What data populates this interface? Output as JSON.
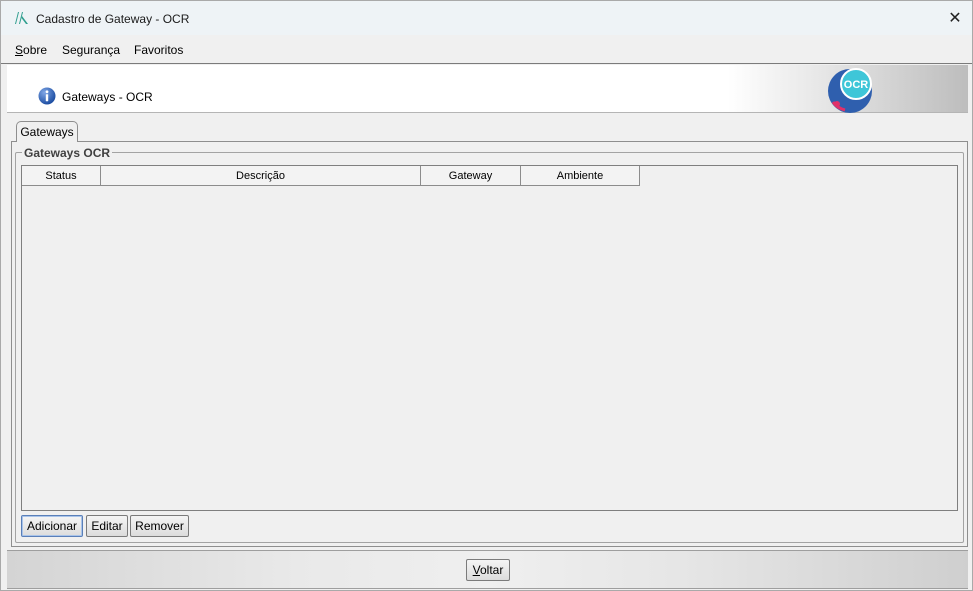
{
  "window": {
    "title": "Cadastro de Gateway - OCR",
    "close_label": "✕"
  },
  "menu": {
    "items": [
      {
        "label_first": "S",
        "label_rest": "obre",
        "full": "Sobre"
      },
      {
        "label": "Segurança"
      },
      {
        "label": "Favoritos"
      }
    ]
  },
  "banner": {
    "title": "Gateways - OCR",
    "logo_text": "OCR"
  },
  "tab": {
    "label": "Gateways"
  },
  "group": {
    "title": "Gateways OCR"
  },
  "table": {
    "columns": [
      "Status",
      "Descrição",
      "Gateway",
      "Ambiente"
    ],
    "rows": []
  },
  "buttons": {
    "add": "Adicionar",
    "edit": "Editar",
    "remove": "Remover"
  },
  "footer": {
    "back_first": "V",
    "back_rest": "oltar"
  },
  "colors": {
    "app_icon": "#2e9e8e",
    "info_icon": "#2a5db0",
    "logo_bg": "#2f5fae",
    "logo_circle": "#3ec6d8",
    "logo_accent": "#e0306a"
  }
}
